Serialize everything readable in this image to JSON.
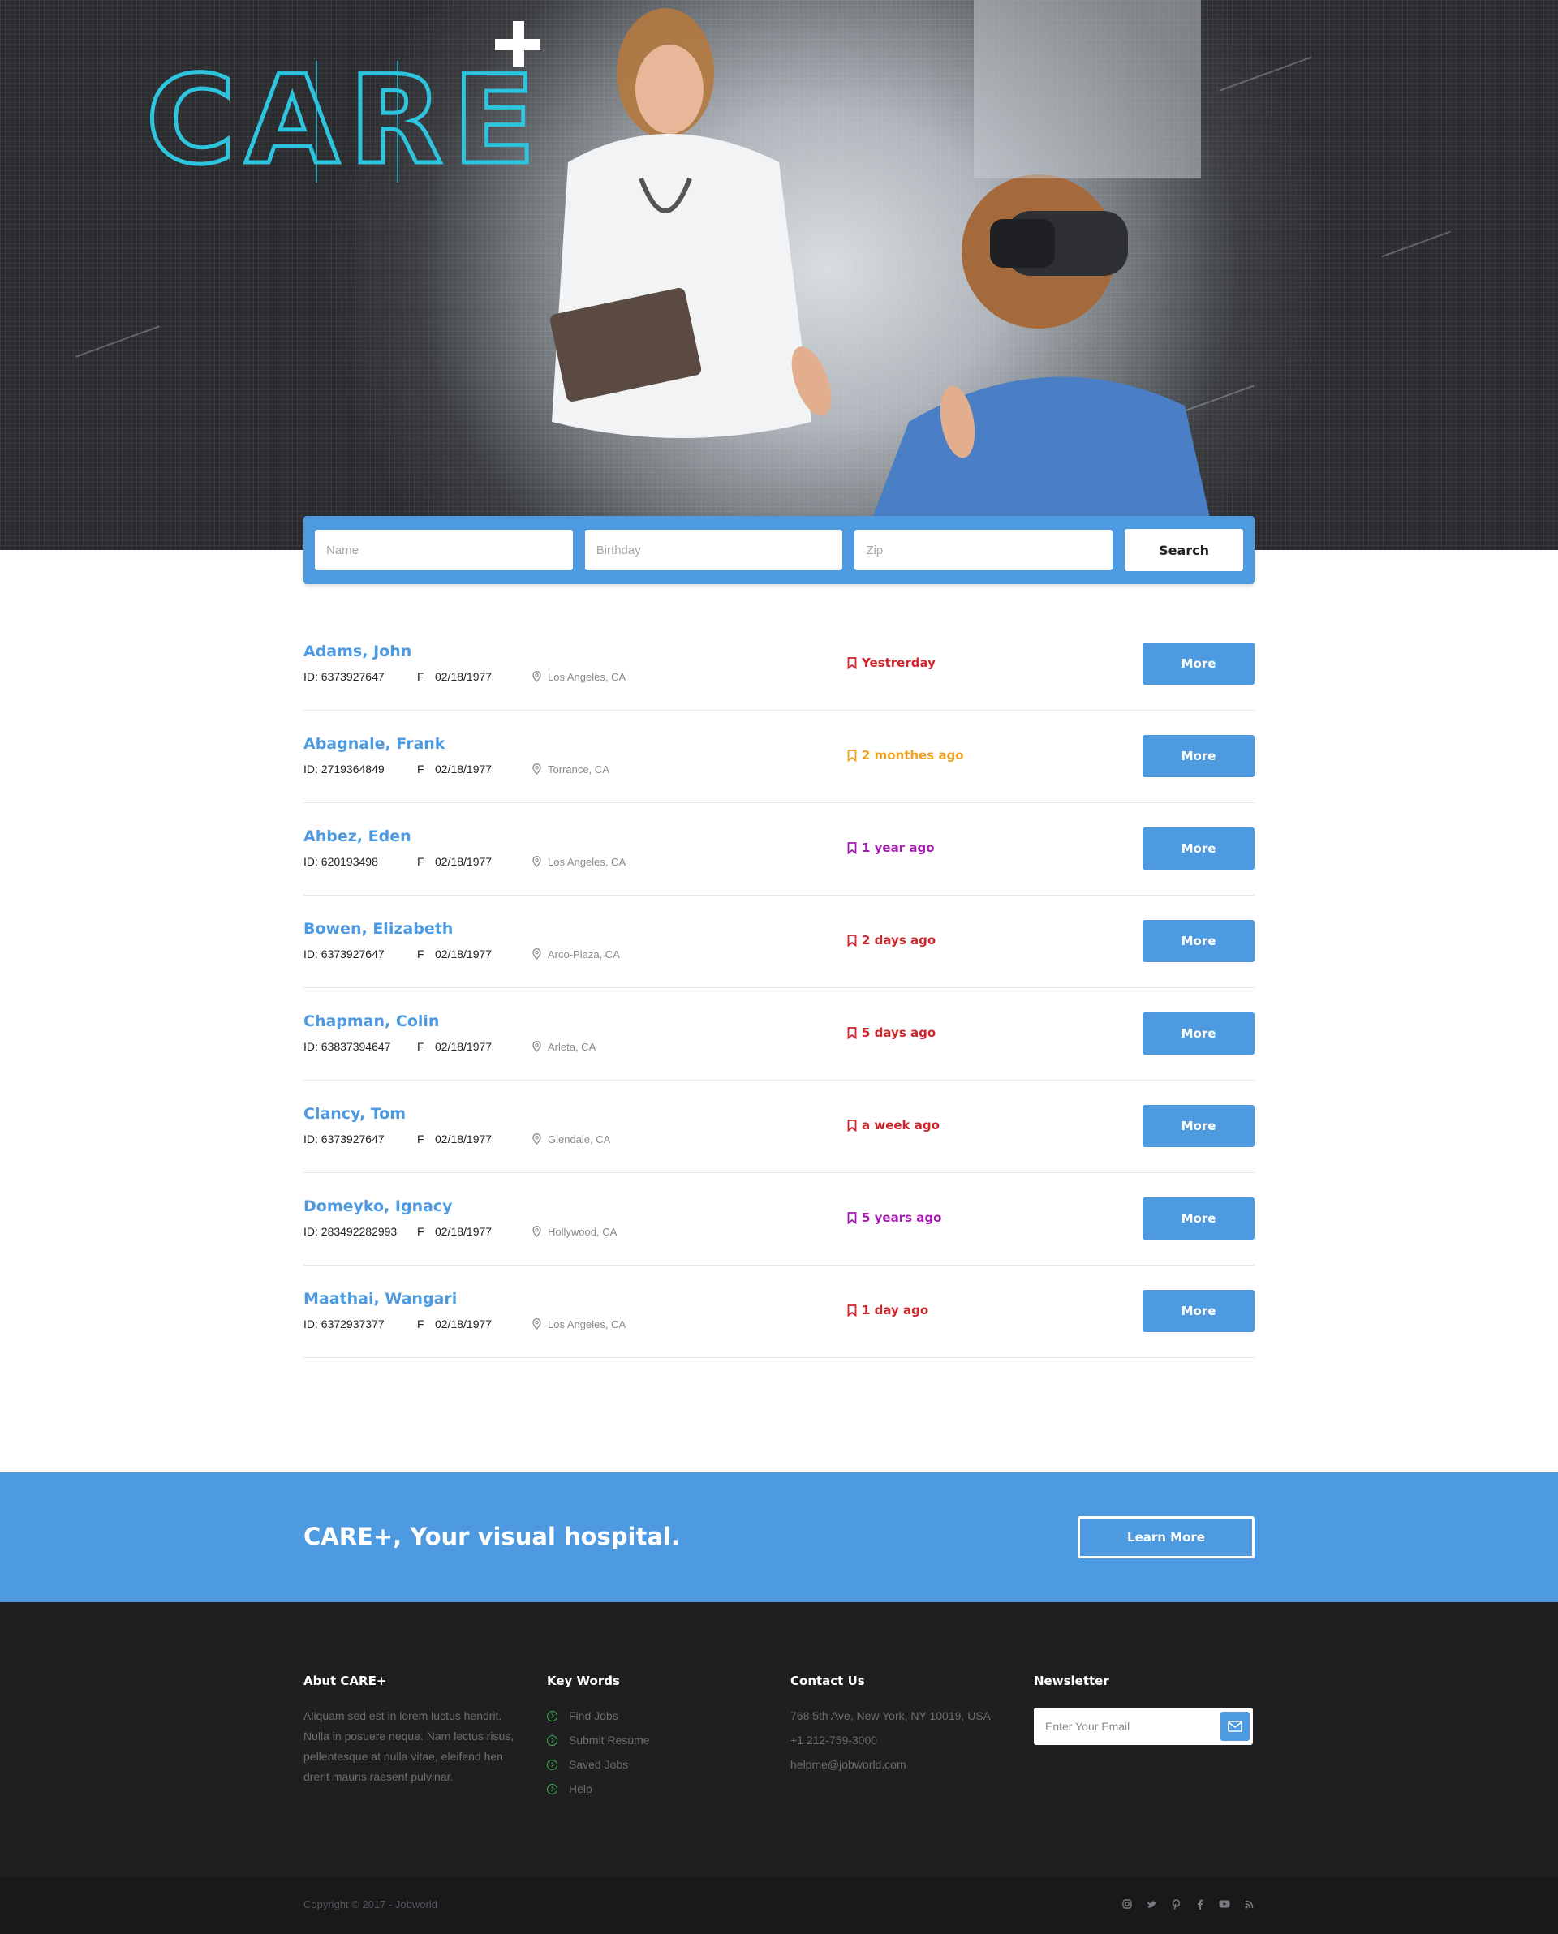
{
  "brand": {
    "logo_text": "CARE"
  },
  "search": {
    "name_placeholder": "Name",
    "birthday_placeholder": "Birthday",
    "zip_placeholder": "Zip",
    "button_label": "Search"
  },
  "results": [
    {
      "name": "Adams, John",
      "id": "ID: 6373927647",
      "sex": "F",
      "dob": "02/18/1977",
      "location": "Los Angeles, CA",
      "when": "Yestrerday",
      "when_color": "#d0242b",
      "more": "More"
    },
    {
      "name": "Abagnale, Frank",
      "id": "ID: 2719364849",
      "sex": "F",
      "dob": "02/18/1977",
      "location": "Torrance, CA",
      "when": "2 monthes ago",
      "when_color": "#f0a21e",
      "more": "More"
    },
    {
      "name": "Ahbez, Eden",
      "id": "ID: 620193498",
      "sex": "F",
      "dob": "02/18/1977",
      "location": "Los Angeles, CA",
      "when": "1 year ago",
      "when_color": "#a21caf",
      "more": "More"
    },
    {
      "name": "Bowen, Elizabeth",
      "id": "ID: 6373927647",
      "sex": "F",
      "dob": "02/18/1977",
      "location": "Arco-Plaza, CA",
      "when": "2 days ago",
      "when_color": "#d0242b",
      "more": "More"
    },
    {
      "name": "Chapman, Colin",
      "id": "ID: 63837394647",
      "sex": "F",
      "dob": "02/18/1977",
      "location": "Arleta, CA",
      "when": "5 days ago",
      "when_color": "#d0242b",
      "more": "More"
    },
    {
      "name": "Clancy, Tom",
      "id": "ID: 6373927647",
      "sex": "F",
      "dob": "02/18/1977",
      "location": "Glendale, CA",
      "when": "a week ago",
      "when_color": "#d0242b",
      "more": "More"
    },
    {
      "name": "Domeyko, Ignacy",
      "id": "ID: 283492282993",
      "sex": "F",
      "dob": "02/18/1977",
      "location": "Hollywood, CA",
      "when": "5 years ago",
      "when_color": "#a21caf",
      "more": "More"
    },
    {
      "name": "Maathai, Wangari",
      "id": "ID: 6372937377",
      "sex": "F",
      "dob": "02/18/1977",
      "location": "Los Angeles, CA",
      "when": "1 day ago",
      "when_color": "#d0242b",
      "more": "More"
    }
  ],
  "cta": {
    "title": "CARE+,  Your visual hospital.",
    "button": "Learn More"
  },
  "footer": {
    "about": {
      "heading": "Abut CARE+",
      "text": "Aliquam sed est in lorem luctus hendrit. Nulla in posuere neque. Nam lectus risus, pellentesque at nulla vitae, eleifend hen drerit mauris raesent pulvinar."
    },
    "keywords": {
      "heading": "Key Words",
      "items": [
        "Find Jobs",
        "Submit Resume",
        "Saved Jobs",
        "Help"
      ]
    },
    "contact": {
      "heading": "Contact Us",
      "address": "768 5th Ave, New York, NY 10019, USA",
      "phone": "+1 212-759-3000",
      "email": "helpme@jobworld.com"
    },
    "newsletter": {
      "heading": "Newsletter",
      "placeholder": "Enter Your Email"
    }
  },
  "bottom": {
    "copyright": "Copyright © 2017 - Jobworld",
    "social_icons": [
      "instagram-icon",
      "twitter-icon",
      "pinterest-icon",
      "facebook-icon",
      "youtube-icon",
      "rss-icon"
    ]
  },
  "colors": {
    "accent": "#4d9ae0",
    "footer_bg": "#1f1f21",
    "bottom_bg": "#19191b",
    "keyword_icon": "#3fae49"
  }
}
